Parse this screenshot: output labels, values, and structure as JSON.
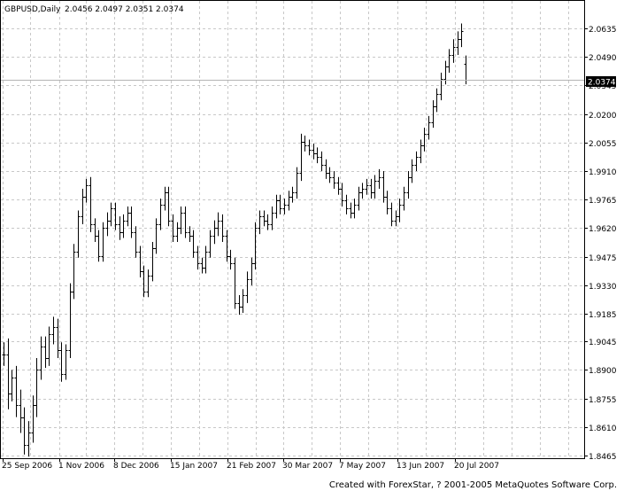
{
  "header": {
    "symbol_timeframe": "GBPUSD,Daily",
    "ohlc_text": "2.0456 2.0497 2.0351 2.0374"
  },
  "footer": {
    "credit": "Created with ForexStar, ? 2001-2005 MetaQuotes Software Corp."
  },
  "chart_data": {
    "type": "bar",
    "style": "ohlc",
    "ylim": [
      1.8465,
      2.078
    ],
    "y_ticks": [
      "2.0635",
      "2.0490",
      "2.0345",
      "2.0200",
      "2.0055",
      "1.9910",
      "1.9765",
      "1.9620",
      "1.9475",
      "1.9330",
      "1.9185",
      "1.9045",
      "1.8900",
      "1.8755",
      "1.8610",
      "1.8465"
    ],
    "x_ticks": [
      "25 Sep 2006",
      "1 Nov 2006",
      "8 Dec 2006",
      "15 Jan 2007",
      "21 Feb 2007",
      "30 Mar 2007",
      "7 May 2007",
      "13 Jun 2007",
      "20 Jul 2007"
    ],
    "current_price": "2.0374",
    "grid": true,
    "colors": {
      "bars": "#000000",
      "grid": "#c8c8c8",
      "price_line": "#b4b4b4",
      "background": "#ffffff"
    },
    "anchors": [
      [
        1.898,
        6
      ],
      [
        1.878,
        8
      ],
      [
        1.886,
        4
      ],
      [
        1.872,
        6
      ],
      [
        1.866,
        8
      ],
      [
        1.852,
        5
      ],
      [
        1.858,
        6
      ],
      [
        1.872,
        5
      ],
      [
        1.89,
        6
      ],
      [
        1.902,
        5
      ],
      [
        1.896,
        5
      ],
      [
        1.908,
        4
      ],
      [
        1.912,
        5
      ],
      [
        1.9,
        4
      ],
      [
        1.888,
        4
      ],
      [
        1.9,
        3
      ],
      [
        1.93,
        4
      ],
      [
        1.95,
        4
      ],
      [
        1.968,
        3
      ],
      [
        1.978,
        4
      ],
      [
        1.984,
        3
      ],
      [
        1.964,
        4
      ],
      [
        1.958,
        3
      ],
      [
        1.948,
        3
      ],
      [
        1.962,
        3
      ],
      [
        1.966,
        4
      ],
      [
        1.972,
        3
      ],
      [
        1.964,
        3
      ],
      [
        1.96,
        4
      ],
      [
        1.966,
        3
      ],
      [
        1.97,
        3
      ],
      [
        1.96,
        3
      ],
      [
        1.95,
        3
      ],
      [
        1.94,
        3
      ],
      [
        1.93,
        3
      ],
      [
        1.938,
        3
      ],
      [
        1.952,
        3
      ],
      [
        1.964,
        3
      ],
      [
        1.974,
        3
      ],
      [
        1.98,
        3
      ],
      [
        1.966,
        3
      ],
      [
        1.958,
        3
      ],
      [
        1.962,
        3
      ],
      [
        1.97,
        3
      ],
      [
        1.96,
        3
      ],
      [
        1.958,
        3
      ],
      [
        1.95,
        3
      ],
      [
        1.944,
        3
      ],
      [
        1.942,
        3
      ],
      [
        1.95,
        3
      ],
      [
        1.958,
        3
      ],
      [
        1.962,
        4
      ],
      [
        1.966,
        4
      ],
      [
        1.958,
        3
      ],
      [
        1.948,
        3
      ],
      [
        1.944,
        3
      ],
      [
        1.924,
        3
      ],
      [
        1.922,
        4
      ],
      [
        1.928,
        3
      ],
      [
        1.936,
        4
      ],
      [
        1.944,
        3
      ],
      [
        1.962,
        3
      ],
      [
        1.968,
        3
      ],
      [
        1.966,
        3
      ],
      [
        1.964,
        3
      ],
      [
        1.97,
        3
      ],
      [
        1.976,
        3
      ],
      [
        1.972,
        3
      ],
      [
        1.974,
        3
      ],
      [
        1.978,
        3
      ],
      [
        1.98,
        3
      ],
      [
        1.99,
        3
      ],
      [
        2.006,
        4
      ],
      [
        2.004,
        3
      ],
      [
        2.002,
        3
      ],
      [
        2.0,
        3
      ],
      [
        1.998,
        3
      ],
      [
        1.994,
        3
      ],
      [
        1.99,
        3
      ],
      [
        1.988,
        3
      ],
      [
        1.985,
        3
      ],
      [
        1.982,
        3
      ],
      [
        1.976,
        3
      ],
      [
        1.972,
        3
      ],
      [
        1.97,
        3
      ],
      [
        1.974,
        3
      ],
      [
        1.98,
        3
      ],
      [
        1.982,
        3
      ],
      [
        1.984,
        3
      ],
      [
        1.98,
        3
      ],
      [
        1.986,
        3
      ],
      [
        1.988,
        4
      ],
      [
        1.978,
        3
      ],
      [
        1.972,
        3
      ],
      [
        1.966,
        3
      ],
      [
        1.968,
        3
      ],
      [
        1.974,
        3
      ],
      [
        1.98,
        3
      ],
      [
        1.988,
        3
      ],
      [
        1.994,
        3
      ],
      [
        1.998,
        3
      ],
      [
        2.004,
        3
      ],
      [
        2.01,
        3
      ],
      [
        2.016,
        3
      ],
      [
        2.024,
        3
      ],
      [
        2.03,
        3
      ],
      [
        2.038,
        3
      ],
      [
        2.044,
        3
      ],
      [
        2.05,
        3
      ],
      [
        2.054,
        4
      ],
      [
        2.058,
        4
      ],
      [
        2.062,
        4
      ],
      [
        2.052,
        4
      ]
    ],
    "last_bar": {
      "open": 2.0456,
      "high": 2.0497,
      "low": 2.0351,
      "close": 2.0374
    }
  }
}
